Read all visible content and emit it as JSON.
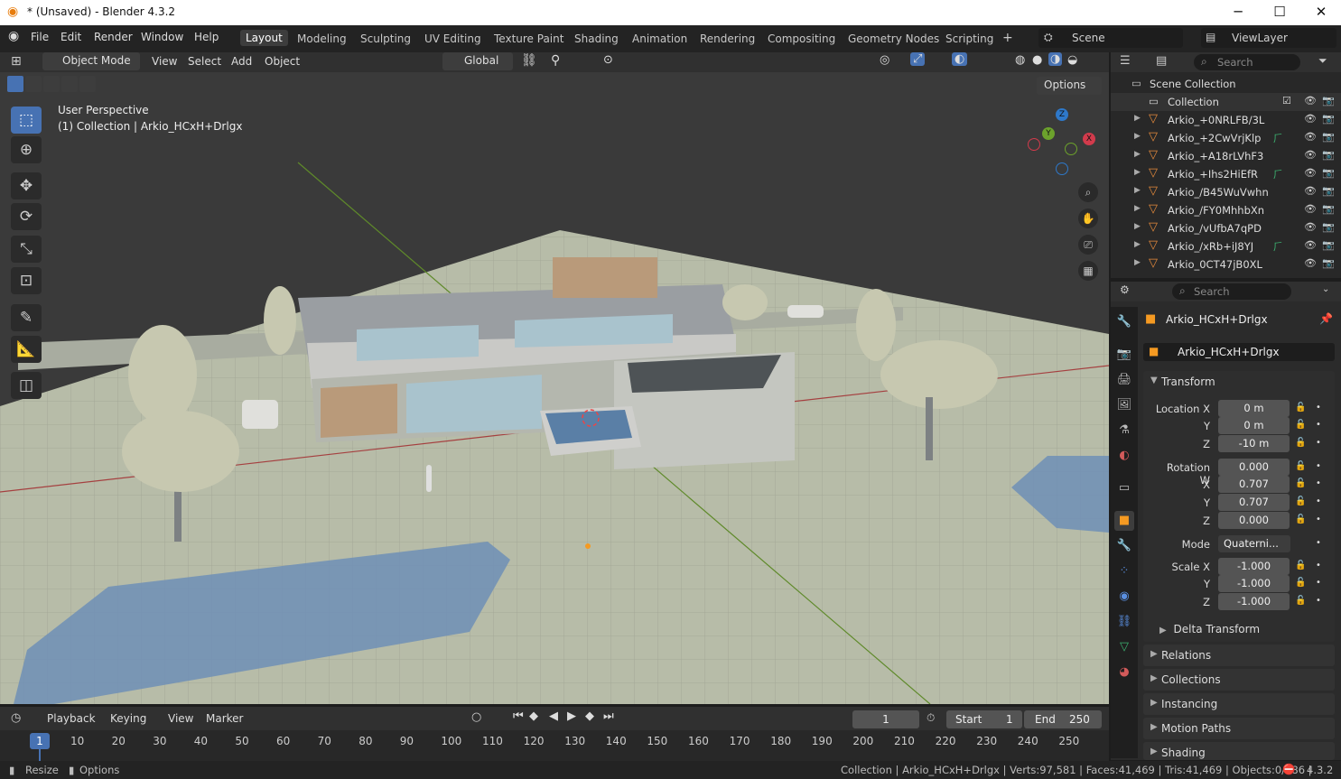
{
  "window": {
    "title": "* (Unsaved) - Blender 4.3.2",
    "minimize": "─",
    "maximize": "☐",
    "close": "✕"
  },
  "menus": [
    "File",
    "Edit",
    "Render",
    "Window",
    "Help"
  ],
  "workspaces": [
    "Layout",
    "Modeling",
    "Sculpting",
    "UV Editing",
    "Texture Paint",
    "Shading",
    "Animation",
    "Rendering",
    "Compositing",
    "Geometry Nodes",
    "Scripting"
  ],
  "add_workspace": "+",
  "scene": {
    "name": "Scene",
    "view_layer": "ViewLayer"
  },
  "viewport_header": {
    "mode": "Object Mode",
    "view": "View",
    "select": "Select",
    "add": "Add",
    "object": "Object",
    "orientation": "Global",
    "options": "Options"
  },
  "viewport": {
    "perspective": "User Perspective",
    "context": "(1) Collection | Arkio_HCxH+Drlgx"
  },
  "gizmo": {
    "z": "Z",
    "y": "Y",
    "x": "X"
  },
  "outliner": {
    "search_placeholder": "Search",
    "scene_collection": "Scene Collection",
    "collection": "Collection",
    "items": [
      "Arkio_+0NRLFB/3L",
      "Arkio_+2CwVrjKlp",
      "Arkio_+A18rLVhF3",
      "Arkio_+Ihs2HiEfR",
      "Arkio_/B45WuVwhn",
      "Arkio_/FY0MhhbXn",
      "Arkio_/vUfbA7qPD",
      "Arkio_/xRb+iJ8YJ",
      "Arkio_0CT47jB0XL"
    ]
  },
  "properties": {
    "search_placeholder": "Search",
    "object_name": "Arkio_HCxH+Drlgx",
    "data_name": "Arkio_HCxH+Drlgx",
    "transform": "Transform",
    "location": {
      "label": "Location X",
      "x": "0 m",
      "y": "0 m",
      "z": "-10 m"
    },
    "rotation": {
      "label": "Rotation W",
      "w": "0.000",
      "x": "0.707",
      "y": "0.707",
      "z": "0.000"
    },
    "mode_label": "Mode",
    "mode": "Quaterni...",
    "scale": {
      "label": "Scale X",
      "x": "-1.000",
      "y": "-1.000",
      "z": "-1.000"
    },
    "axis": {
      "y": "Y",
      "z": "Z",
      "x": "X"
    },
    "delta": "Delta Transform",
    "panels": [
      "Relations",
      "Collections",
      "Instancing",
      "Motion Paths",
      "Shading"
    ]
  },
  "timeline": {
    "playback": "Playback",
    "keying": "Keying",
    "view": "View",
    "marker": "Marker",
    "current": "1",
    "start_label": "Start",
    "start": "1",
    "end_label": "End",
    "end": "250",
    "frames": [
      "10",
      "20",
      "30",
      "40",
      "50",
      "60",
      "70",
      "80",
      "90",
      "100",
      "110",
      "120",
      "130",
      "140",
      "150",
      "160",
      "170",
      "180",
      "190",
      "200",
      "210",
      "220",
      "230",
      "240",
      "250"
    ],
    "current_marker": "1"
  },
  "status": {
    "resize": "Resize",
    "options": "Options",
    "stats": "Collection | Arkio_HCxH+Drlgx | Verts:97,581 | Faces:41,469 | Tris:41,469 | Objects:0/386 |",
    "version": "4.3.2"
  }
}
